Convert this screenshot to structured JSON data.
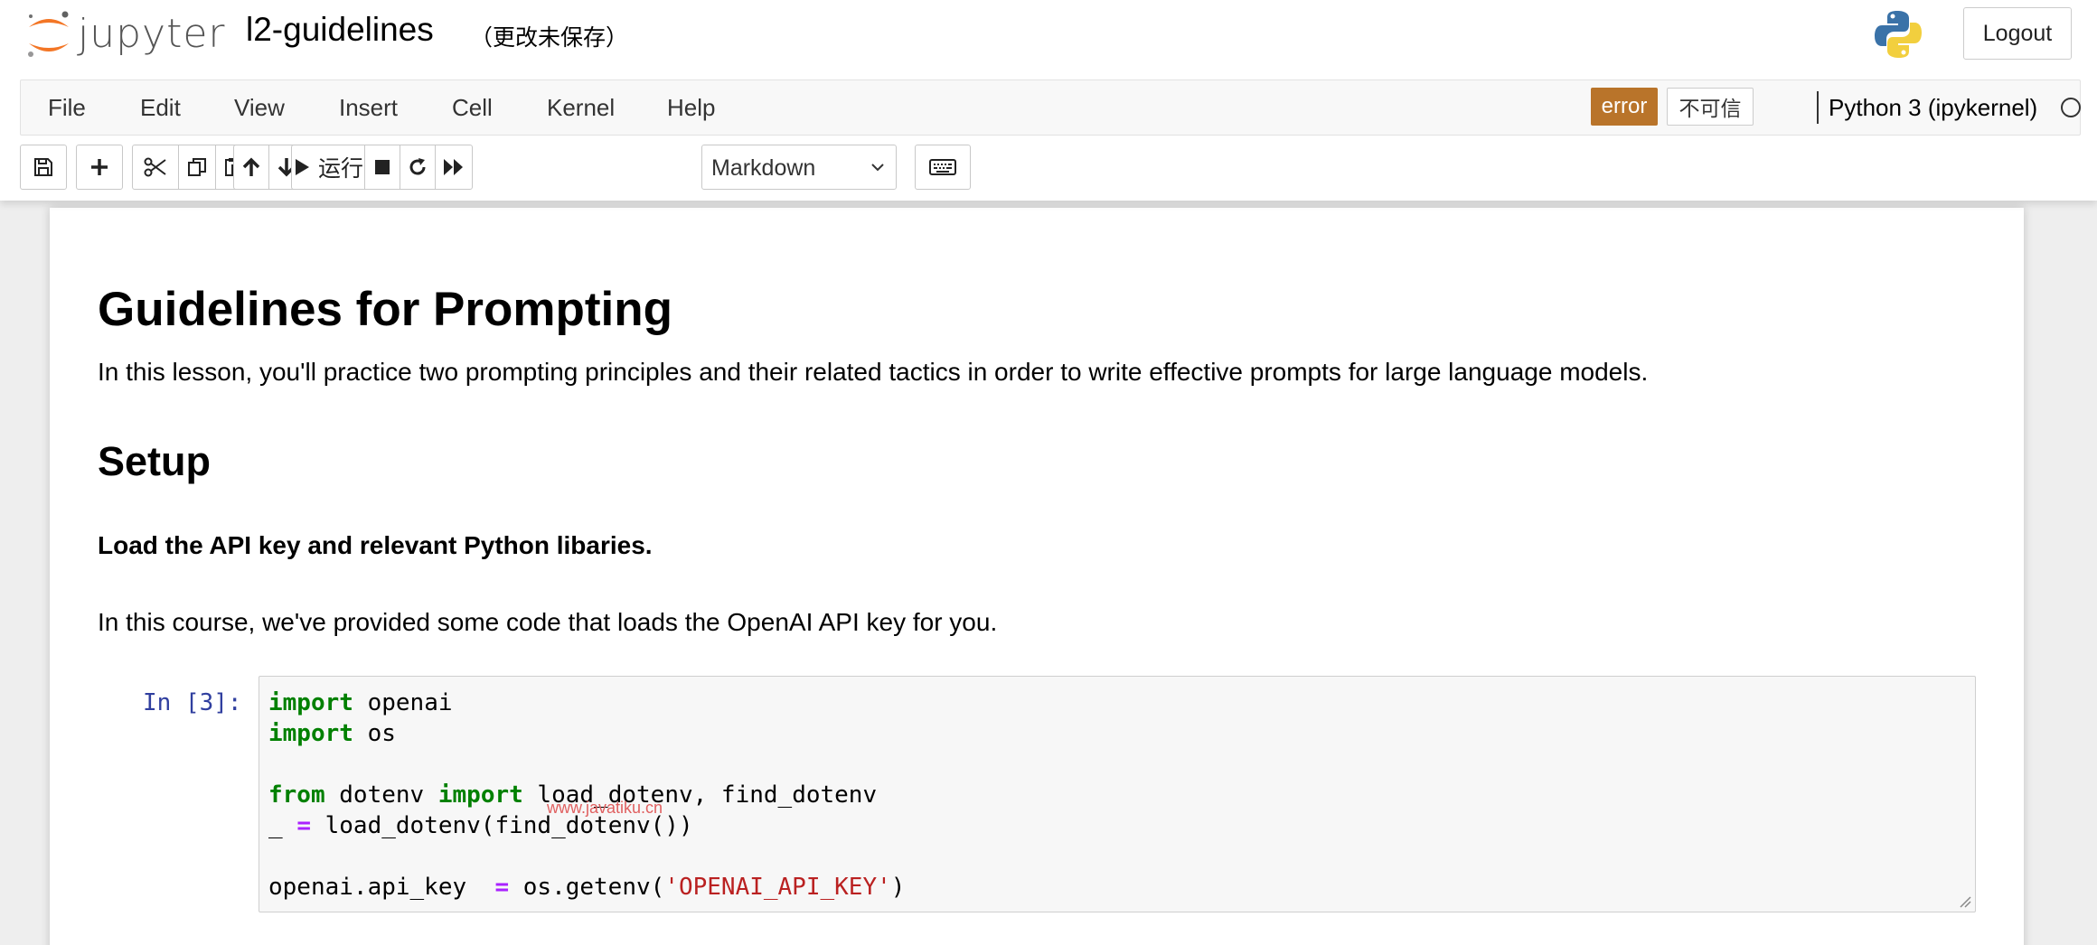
{
  "header": {
    "logo_text": "jupyter",
    "notebook_name": "l2-guidelines",
    "save_status": "（更改未保存）",
    "logout_label": "Logout"
  },
  "menubar": {
    "items": [
      "File",
      "Edit",
      "View",
      "Insert",
      "Cell",
      "Kernel",
      "Help"
    ],
    "error_badge": "error",
    "trust_badge": "不可信",
    "kernel_name": "Python 3 (ipykernel)"
  },
  "toolbar": {
    "run_label": "运行",
    "cell_type": "Markdown",
    "buttons": [
      "save-icon",
      "plus-icon",
      "cut-icon",
      "copy-icon",
      "paste-icon",
      "arrow-up-icon",
      "arrow-down-icon",
      "play-icon",
      "stop-icon",
      "restart-icon",
      "fast-forward-icon",
      "keyboard-icon"
    ]
  },
  "notebook": {
    "title": "Guidelines for Prompting",
    "intro": "In this lesson, you'll practice two prompting principles and their related tactics in order to write effective prompts for large language models.",
    "setup_heading": "Setup",
    "bold_line": "Load the API key and relevant Python libaries.",
    "course_line": "In this course, we've provided some code that loads the OpenAI API key for you.",
    "cell_prompt": "In [3]:",
    "code": {
      "l1_kw": "import",
      "l1_rest": " openai",
      "l2_kw": "import",
      "l2_rest": " os",
      "l4_kw1": "from",
      "l4_mid": " dotenv ",
      "l4_kw2": "import",
      "l4_rest": " load_dotenv, find_dotenv",
      "l5_a": "_ ",
      "l5_op": "=",
      "l5_rest": " load_dotenv(find_dotenv())",
      "l7_a": "openai.api_key  ",
      "l7_op": "=",
      "l7_mid": " os.getenv(",
      "l7_str": "'OPENAI_API_KEY'",
      "l7_end": ")"
    },
    "watermark": "www.javatiku.cn"
  },
  "colors": {
    "error_badge": "#b9742a",
    "prompt": "#303f9f",
    "keyword": "#008000",
    "operator": "#aa22ff",
    "string": "#ba2121",
    "jupyter_orange": "#f37626"
  }
}
